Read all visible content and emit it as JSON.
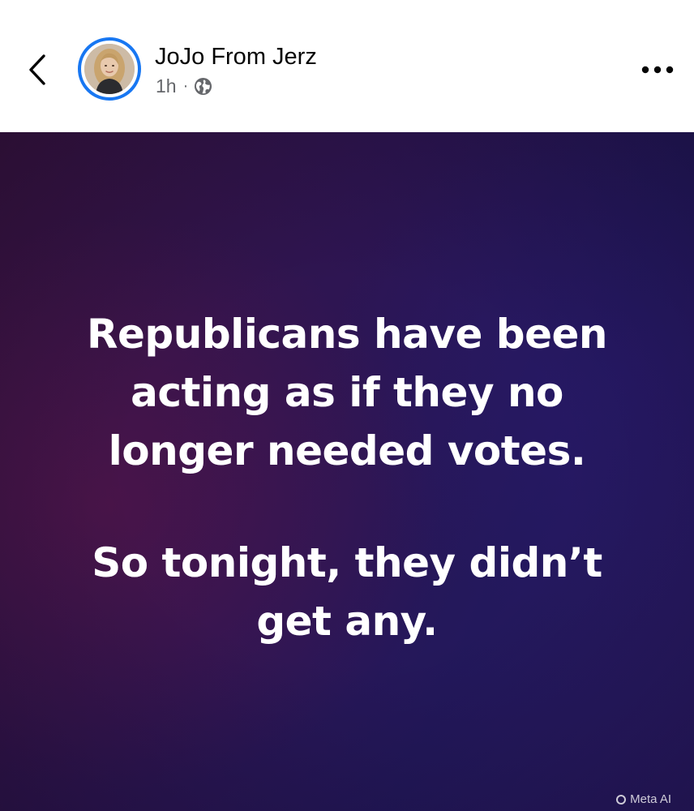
{
  "header": {
    "author_name": "JoJo From Jerz",
    "timestamp": "1h",
    "separator": "·",
    "audience_icon": "globe-icon",
    "back_icon": "chevron-left-icon",
    "more_icon": "more-horizontal-icon"
  },
  "post": {
    "paragraph_1": [
      "Republicans have been",
      "acting as if they no",
      "longer needed votes."
    ],
    "paragraph_2": [
      "So tonight, they didn’t",
      "get any."
    ],
    "badge_label": "Meta AI"
  },
  "colors": {
    "accent": "#1877f2",
    "name_text": "#050505",
    "meta_text": "#65676b",
    "post_bg_start": "#3a1340",
    "post_bg_end": "#2a1a66"
  }
}
